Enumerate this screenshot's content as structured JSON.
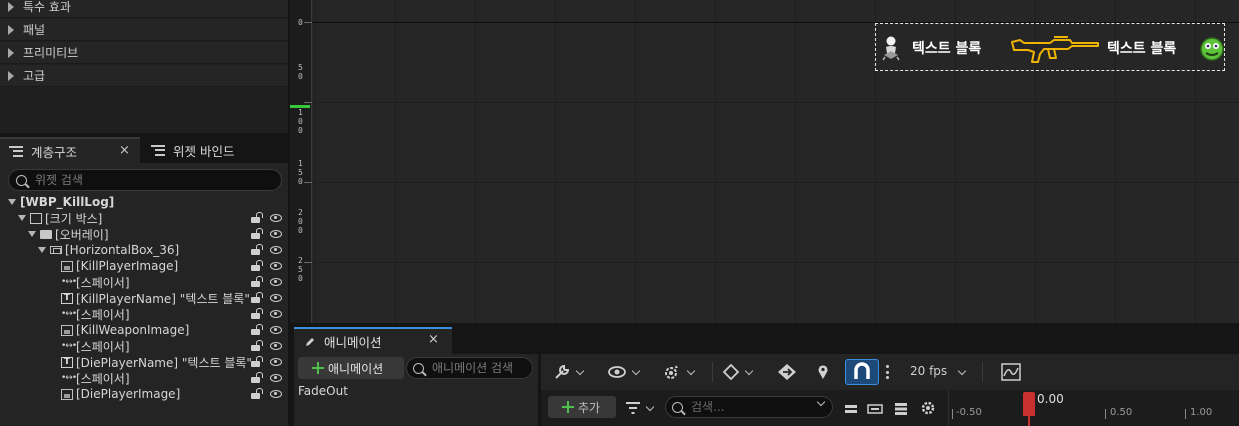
{
  "palette": {
    "categories": [
      "특수 효과",
      "패널",
      "프리미티브",
      "고급"
    ]
  },
  "left_tabs": {
    "hierarchy": "계층구조",
    "widget_binding": "위젯 바인드",
    "close": "×"
  },
  "hierarchy": {
    "search_placeholder": "위젯 검색",
    "items": [
      "[WBP_KillLog]",
      "[크기 박스]",
      "[오버레이]",
      "[HorizontalBox_36]",
      "[KillPlayerImage]",
      "[스페이서]",
      "[KillPlayerName] \"텍스트 블록\"",
      "[스페이서]",
      "[KillWeaponImage]",
      "[스페이서]",
      "[DiePlayerName] \"텍스트 블록\"",
      "[스페이서]",
      "[DiePlayerImage]"
    ]
  },
  "designer": {
    "ruler_labels": [
      "0",
      "5",
      "0",
      "1",
      "0",
      "0",
      "1",
      "5",
      "0",
      "2",
      "0",
      "0",
      "2",
      "5",
      "0"
    ],
    "killlog": {
      "killer_name": "텍스트 블록",
      "victim_name": "텍스트 블록"
    }
  },
  "animation": {
    "tab_label": "애니메이션",
    "close": "×",
    "add_button": "애니메이션",
    "search_placeholder": "애니메이션 검색",
    "items": [
      "FadeOut"
    ]
  },
  "sequencer": {
    "fps": "20 fps",
    "add_track": "추가",
    "search_placeholder": "검색...",
    "playhead_time": "0.00",
    "timeline_labels": [
      "-0.50",
      "0.50",
      "1.00"
    ]
  },
  "icons": {
    "wrench": "wrench-icon",
    "eye": "eye-icon",
    "cog": "cog-icon",
    "key": "keyframe-icon",
    "pin": "pin-icon",
    "magnet": "magnet-icon"
  },
  "colors": {
    "accent": "#3b8ee0",
    "add_green": "#4cc24c",
    "playhead": "#c83030",
    "weapon_gold": "#f0b400"
  }
}
